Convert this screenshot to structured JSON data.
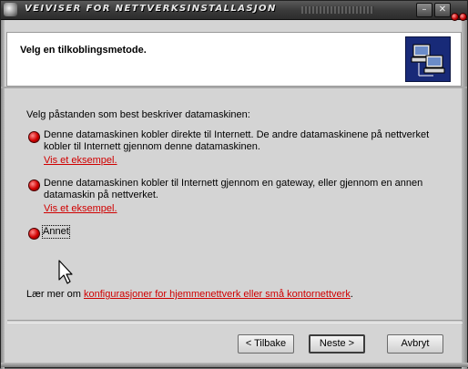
{
  "window": {
    "title": "VEIVISER FOR NETTVERKSINSTALLASJON",
    "min_glyph": "–",
    "close_glyph": "✕"
  },
  "header": {
    "title": "Velg en tilkoblingsmetode."
  },
  "body": {
    "prompt": "Velg påstanden som best beskriver datamaskinen:",
    "options": [
      {
        "lines": [
          "Denne datamaskinen kobler direkte til Internett. De andre datamaskinene på nettverket",
          "kobler til Internett gjennom denne datamaskinen."
        ],
        "link": "Vis et eksempel."
      },
      {
        "lines": [
          "Denne datamaskinen kobler til Internett gjennom en gateway, eller gjennom en annen",
          "datamaskin på nettverket."
        ],
        "link": "Vis et eksempel."
      },
      {
        "lines": [
          "Annet"
        ],
        "link": ""
      }
    ],
    "learn_prefix": "Lær mer om ",
    "learn_link": "konfigurasjoner for hjemmenettverk eller små kontornettverk",
    "learn_suffix": "."
  },
  "buttons": {
    "back": "< Tilbake",
    "next": "Neste >",
    "cancel": "Avbryt"
  },
  "colors": {
    "accent_red": "#d00000",
    "header_image_bg": "#182a78"
  }
}
